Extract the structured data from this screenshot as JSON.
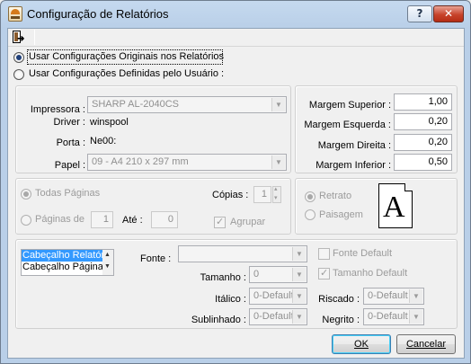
{
  "window": {
    "title": "Configuração de Relatórios",
    "help_label": "?",
    "close_label": "✕"
  },
  "toolbar": {
    "exit_icon": "exit-door-icon"
  },
  "config_mode": {
    "original_label": "Usar Configurações Originais nos Relatórios",
    "user_label": "Usar Configurações Definidas pelo Usuário :",
    "selected": "original"
  },
  "printer": {
    "impressora_label": "Impressora :",
    "impressora_value": "SHARP AL-2040CS",
    "driver_label": "Driver :",
    "driver_value": "winspool",
    "porta_label": "Porta :",
    "porta_value": "Ne00:",
    "papel_label": "Papel :",
    "papel_value": "09  - A4 210 x 297 mm"
  },
  "margins": {
    "superior_label": "Margem Superior :",
    "superior_value": "1,00",
    "esquerda_label": "Margem Esquerda :",
    "esquerda_value": "0,20",
    "direita_label": "Margem Direita :",
    "direita_value": "0,20",
    "inferior_label": "Margem Inferior :",
    "inferior_value": "0,50"
  },
  "pages": {
    "todas_label": "Todas Páginas",
    "paginas_de_label": "Páginas de",
    "paginas_de_value": "1",
    "ate_label": "Até :",
    "ate_value": "0",
    "copias_label": "Cópias :",
    "copias_value": "1",
    "agrupar_label": "Agrupar",
    "agrupar_checked": true
  },
  "orientation": {
    "retrato_label": "Retrato",
    "paisagem_label": "Paisagem",
    "selected": "retrato",
    "preview_letter": "A"
  },
  "sections": {
    "items": [
      "Cabeçalho Relatório",
      "Cabeçalho Página"
    ],
    "selected_index": 0
  },
  "font": {
    "fonte_label": "Fonte :",
    "fonte_value": "",
    "fonte_default_label": "Fonte Default",
    "tamanho_label": "Tamanho :",
    "tamanho_value": "0",
    "tamanho_default_label": "Tamanho Default",
    "tamanho_default_checked": true,
    "italico_label": "Itálico :",
    "italico_value": "0-Default",
    "riscado_label": "Riscado :",
    "riscado_value": "0-Default",
    "sublinhado_label": "Sublinhado :",
    "sublinhado_value": "0-Default",
    "negrito_label": "Negrito :",
    "negrito_value": "0-Default"
  },
  "buttons": {
    "ok_label": "OK",
    "cancel_label": "Cancelar"
  }
}
